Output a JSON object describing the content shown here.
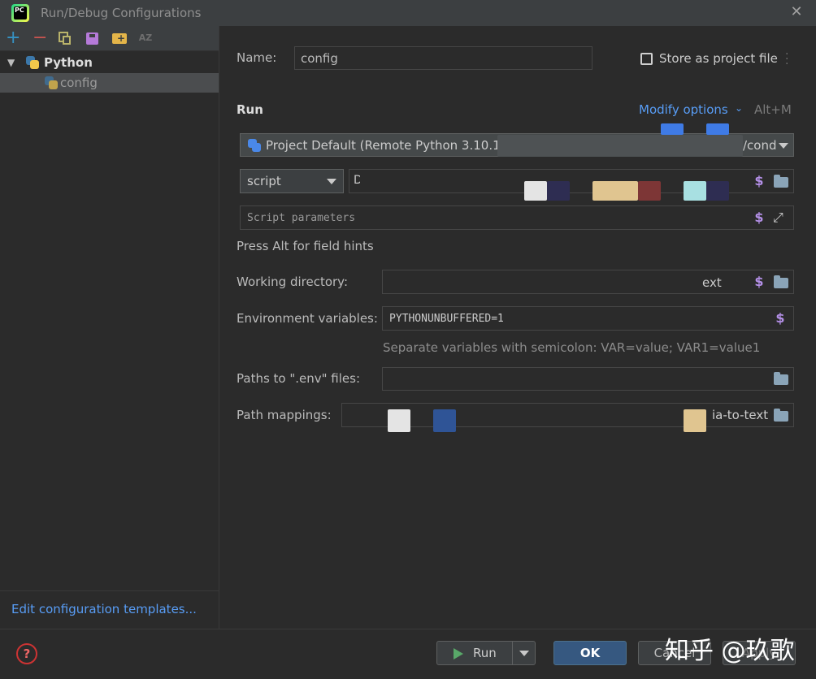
{
  "window": {
    "title": "Run/Debug Configurations",
    "app_icon_text": "PC"
  },
  "toolbar": {
    "sort_label": "AZ"
  },
  "tree": {
    "group_label": "Python",
    "item_label": "config"
  },
  "left_footer": {
    "edit_templates": "Edit configuration templates..."
  },
  "form": {
    "name_label": "Name:",
    "name_value": "config",
    "store_label": "Store as project file",
    "run_section": "Run",
    "modify_options": "Modify options",
    "modify_shortcut": "Alt+M",
    "interpreter_value": "Project Default (Remote Python 3.10.13",
    "interpreter_suffix": "/cond",
    "script_type": "script",
    "script_path_partial": "D",
    "script_params_placeholder": "Script parameters",
    "hint_text": "Press Alt for field hints",
    "working_dir_label": "Working directory:",
    "working_dir_suffix": "ext",
    "env_label": "Environment variables:",
    "env_value": "PYTHONUNBUFFERED=1",
    "env_hint": "Separate variables with semicolon: VAR=value; VAR1=value1",
    "dotenv_label": "Paths to \".env\" files:",
    "path_mappings_label": "Path mappings:",
    "path_mappings_suffix": "ia-to-text"
  },
  "buttons": {
    "run": "Run",
    "ok": "OK",
    "cancel": "Cancel",
    "apply": "Apply",
    "help": "?"
  },
  "watermark": "知乎 @玖歌",
  "colors": {
    "accent": "#589df6",
    "ok_button": "#365880",
    "background": "#2b2b2b",
    "panel": "#3c3f41",
    "dollar": "#b38fe6"
  }
}
